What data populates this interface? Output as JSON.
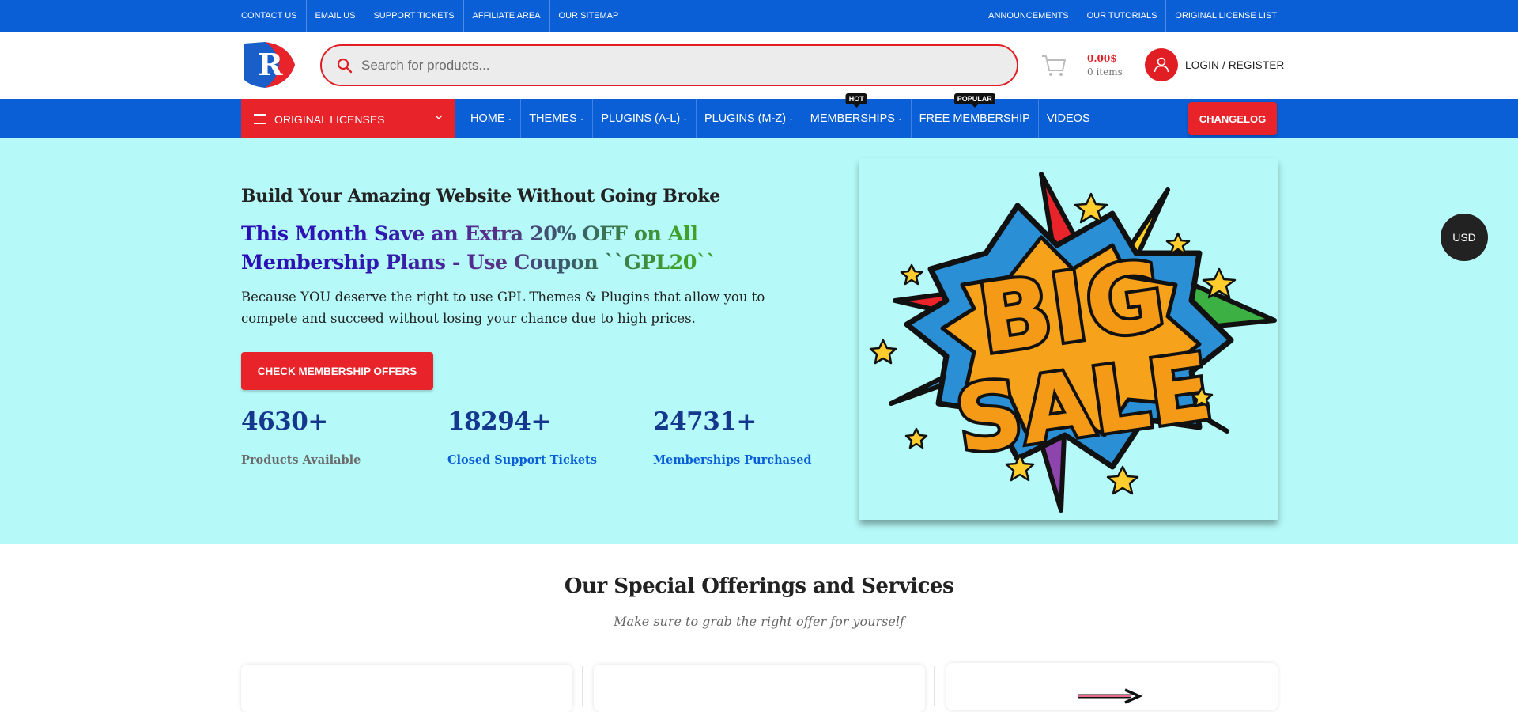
{
  "topbar": {
    "left_links": [
      "CONTACT US",
      "EMAIL US",
      "SUPPORT TICKETS",
      "AFFILIATE AREA",
      "OUR SITEMAP"
    ],
    "right_links": [
      "ANNOUNCEMENTS",
      "OUR TUTORIALS",
      "ORIGINAL LICENSE LIST"
    ]
  },
  "header": {
    "search_placeholder": "Search for products...",
    "cart_amount": "0.00$",
    "cart_items": "0 items",
    "login_label": "LOGIN / REGISTER"
  },
  "nav": {
    "category_label": "ORIGINAL LICENSES",
    "items": [
      {
        "label": "HOME",
        "dropdown": true,
        "badge": ""
      },
      {
        "label": "THEMES",
        "dropdown": true,
        "badge": ""
      },
      {
        "label": "PLUGINS (A-L)",
        "dropdown": true,
        "badge": ""
      },
      {
        "label": "PLUGINS (M-Z)",
        "dropdown": true,
        "badge": ""
      },
      {
        "label": "MEMBERSHIPS",
        "dropdown": true,
        "badge": "HOT"
      },
      {
        "label": "FREE MEMBERSHIP",
        "dropdown": false,
        "badge": "POPULAR"
      },
      {
        "label": "VIDEOS",
        "dropdown": false,
        "badge": ""
      }
    ],
    "changelog_label": "CHANGELOG"
  },
  "hero": {
    "subtitle": "Build Your Amazing Website Without Going Broke",
    "title": "This Month Save an Extra 20% OFF on All Membership Plans - Use Coupon ``GPL20``",
    "description": "Because YOU deserve the right to use GPL Themes & Plugins that allow you to compete and succeed without losing your chance due to high prices.",
    "cta_label": "CHECK MEMBERSHIP OFFERS",
    "stats": [
      {
        "value": "4630+",
        "label": "Products Available",
        "color": "#6b6b6b"
      },
      {
        "value": "18294+",
        "label": "Closed Support Tickets",
        "color": "#0a5fd6"
      },
      {
        "value": "24731+",
        "label": "Memberships Purchased",
        "color": "#0a5fd6"
      }
    ],
    "image_text_line1": "BIG",
    "image_text_line2": "SALE"
  },
  "currency": "USD",
  "offerings": {
    "title": "Our Special Offerings and Services",
    "subtitle": "Make sure to grab the right offer for yourself"
  },
  "colors": {
    "brand_blue": "#0a5fd6",
    "brand_red": "#e8232a",
    "hero_bg": "#b5f9f8"
  }
}
